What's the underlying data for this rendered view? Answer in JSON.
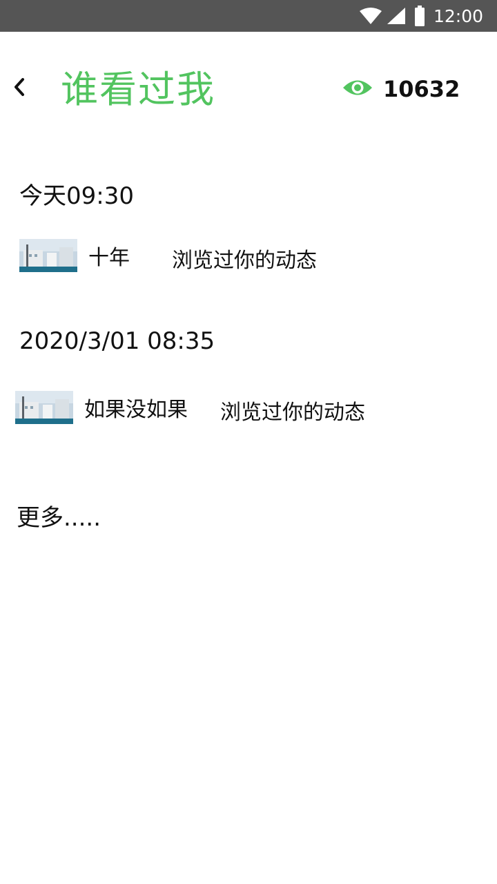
{
  "status_bar": {
    "time": "12:00"
  },
  "header": {
    "title": "谁看过我",
    "view_count": "10632",
    "accent_color": "#52c45f"
  },
  "visits": [
    {
      "date": "今天09:30",
      "user": "十年",
      "action": "浏览过你的动态"
    },
    {
      "date": "2020/3/01 08:35",
      "user": "如果没如果",
      "action": "浏览过你的动态"
    }
  ],
  "more": "更多.....",
  "icons": {
    "back": "chevron-left-icon",
    "views": "eye-icon",
    "wifi": "wifi-icon",
    "signal": "signal-icon",
    "battery": "battery-icon"
  }
}
